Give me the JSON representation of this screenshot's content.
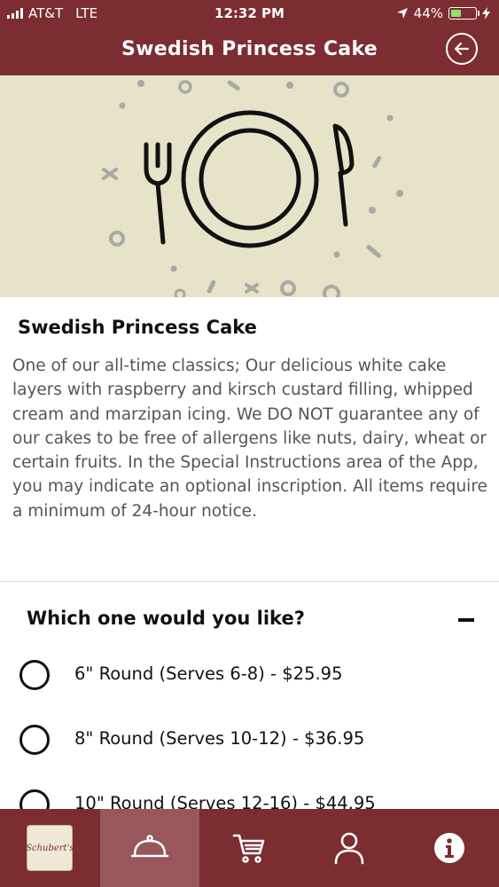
{
  "status_bar": {
    "carrier": "AT&T",
    "network": "LTE",
    "time": "12:32 PM",
    "battery": "44%",
    "battery_level": 0.44
  },
  "header": {
    "title": "Swedish Princess Cake",
    "back_icon": "back-arrow-circle-icon"
  },
  "hero": {
    "icon": "plate-fork-knife-icon",
    "background_color": "#e6e3c8"
  },
  "product": {
    "name": "Swedish Princess Cake",
    "description": "One of our all-time classics; Our delicious white cake layers with raspberry and kirsch custard filling, whipped cream and marzipan icing. We DO NOT guarantee any of our cakes to be free of allergens like nuts, dairy, wheat or certain fruits. In the Special Instructions area of the App, you may indicate an optional inscription. All items require a minimum of 24-hour notice."
  },
  "options": {
    "title": "Which one would you like?",
    "collapse_icon": "minus-icon",
    "items": [
      {
        "label": "6\" Round (Serves 6-8) - $25.95",
        "selected": false
      },
      {
        "label": "8\" Round (Serves 10-12) - $36.95",
        "selected": false
      },
      {
        "label": "10\" Round (Serves 12-16) - $44.95",
        "selected": false
      }
    ]
  },
  "tabbar": {
    "items": [
      {
        "name": "home",
        "icon": "schuberts-logo-icon",
        "logo_text": "Schubert's"
      },
      {
        "name": "menu",
        "icon": "cloche-icon",
        "active": true
      },
      {
        "name": "cart",
        "icon": "cart-icon"
      },
      {
        "name": "account",
        "icon": "user-icon"
      },
      {
        "name": "info",
        "icon": "info-icon"
      }
    ]
  },
  "colors": {
    "brand": "#7b2d31",
    "active_tab": "#97575b",
    "battery": "#8ee16a"
  }
}
